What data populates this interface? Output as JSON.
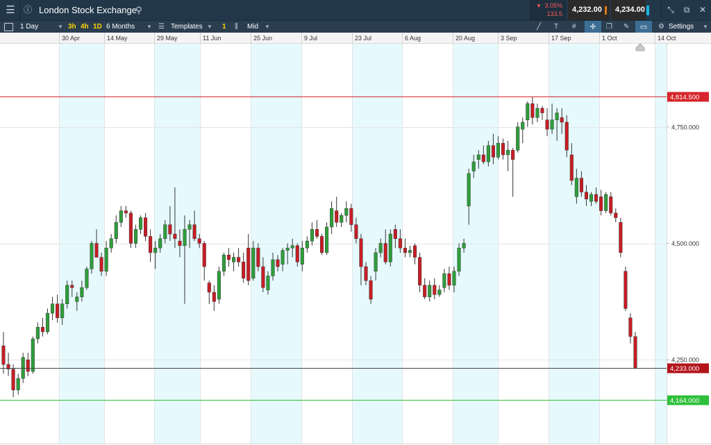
{
  "app": {
    "instrument": "London Stock Exchange",
    "change_pct": "3.05%",
    "change_pts": "133.5",
    "sell_price": "4,232.00",
    "buy_price": "4,234.00"
  },
  "toolbar": {
    "interval": "1 Day",
    "quick_intervals": [
      "3h",
      "4h",
      "1D"
    ],
    "range": "6 Months",
    "templates_label": "Templates",
    "template_count": "1",
    "price_type": "Mid",
    "settings_label": "Settings"
  },
  "colors": {
    "up_candle": "#2e9e3a",
    "down_candle": "#c81d25",
    "high_line": "#d6262b",
    "low_line": "#2fbf3a",
    "current_line": "#444444",
    "highlight_band": "#e6fafd",
    "titlebar": "#22384a",
    "toolbar": "#2a3e50"
  },
  "icons": [
    "menu-icon",
    "info-icon",
    "search-icon",
    "down-arrow-icon",
    "chart-type-icon",
    "candles-icon",
    "draw-line-icon",
    "text-tool-icon",
    "grid-icon",
    "crosshair-icon",
    "layers-icon",
    "drawing-tool-icon",
    "shape-icon",
    "gear-icon",
    "shrink-icon",
    "popout-icon",
    "close-icon"
  ],
  "chart_data": {
    "type": "candlestick",
    "x_tick_labels": [
      "30 Apr",
      "14 May",
      "29 May",
      "11 Jun",
      "25 Jun",
      "9 Jul",
      "23 Jul",
      "6 Aug",
      "20 Aug",
      "3 Sep",
      "17 Sep",
      "1 Oct",
      "14 Oct"
    ],
    "y_ticks": [
      4250,
      4500,
      4750
    ],
    "y_tick_labels": [
      "4,250.000",
      "4,500.000",
      "4,750.000"
    ],
    "ylim": [
      4070,
      4930
    ],
    "grid": true,
    "high_marker": {
      "value": 4814.5,
      "label": "4,814.500"
    },
    "low_marker": {
      "value": 4164.0,
      "label": "4,164.000"
    },
    "current_marker": {
      "value": 4233.0,
      "label": "4,233.000"
    },
    "candles": [
      [
        4280,
        4310,
        4220,
        4240
      ],
      [
        4240,
        4265,
        4215,
        4230
      ],
      [
        4230,
        4240,
        4170,
        4185
      ],
      [
        4185,
        4220,
        4175,
        4210
      ],
      [
        4210,
        4265,
        4200,
        4255
      ],
      [
        4250,
        4265,
        4215,
        4225
      ],
      [
        4225,
        4300,
        4220,
        4295
      ],
      [
        4295,
        4330,
        4285,
        4320
      ],
      [
        4320,
        4340,
        4300,
        4310
      ],
      [
        4310,
        4360,
        4305,
        4350
      ],
      [
        4350,
        4385,
        4335,
        4370
      ],
      [
        4370,
        4390,
        4330,
        4340
      ],
      [
        4340,
        4380,
        4325,
        4370
      ],
      [
        4370,
        4420,
        4360,
        4410
      ],
      [
        4410,
        4420,
        4385,
        4405
      ],
      [
        4375,
        4395,
        4355,
        4385
      ],
      [
        4385,
        4420,
        4375,
        4405
      ],
      [
        4405,
        4450,
        4400,
        4445
      ],
      [
        4445,
        4505,
        4435,
        4500
      ],
      [
        4500,
        4530,
        4470,
        4470
      ],
      [
        4470,
        4480,
        4430,
        4440
      ],
      [
        4440,
        4505,
        4430,
        4490
      ],
      [
        4490,
        4520,
        4480,
        4510
      ],
      [
        4510,
        4560,
        4500,
        4545
      ],
      [
        4545,
        4580,
        4535,
        4570
      ],
      [
        4570,
        4580,
        4555,
        4565
      ],
      [
        4565,
        4570,
        4490,
        4500
      ],
      [
        4500,
        4540,
        4490,
        4530
      ],
      [
        4530,
        4560,
        4520,
        4555
      ],
      [
        4555,
        4565,
        4505,
        4515
      ],
      [
        4515,
        4530,
        4460,
        4480
      ],
      [
        4480,
        4505,
        4445,
        4490
      ],
      [
        4490,
        4520,
        4480,
        4510
      ],
      [
        4510,
        4550,
        4500,
        4540
      ],
      [
        4540,
        4580,
        4505,
        4520
      ],
      [
        4520,
        4620,
        4490,
        4510
      ],
      [
        4505,
        4530,
        4470,
        4495
      ],
      [
        4495,
        4560,
        4370,
        4530
      ],
      [
        4530,
        4550,
        4490,
        4540
      ],
      [
        4540,
        4570,
        4505,
        4510
      ],
      [
        4510,
        4520,
        4490,
        4500
      ],
      [
        4500,
        4505,
        4420,
        4450
      ],
      [
        4415,
        4420,
        4370,
        4395
      ],
      [
        4395,
        4410,
        4355,
        4375
      ],
      [
        4380,
        4450,
        4370,
        4440
      ],
      [
        4440,
        4480,
        4430,
        4475
      ],
      [
        4475,
        4490,
        4450,
        4465
      ],
      [
        4460,
        4480,
        4440,
        4470
      ],
      [
        4470,
        4490,
        4450,
        4460
      ],
      [
        4460,
        4480,
        4415,
        4425
      ],
      [
        4490,
        4520,
        4410,
        4420
      ],
      [
        4425,
        4505,
        4420,
        4490
      ],
      [
        4490,
        4500,
        4440,
        4450
      ],
      [
        4450,
        4470,
        4395,
        4405
      ],
      [
        4400,
        4440,
        4390,
        4430
      ],
      [
        4430,
        4480,
        4420,
        4465
      ],
      [
        4465,
        4475,
        4440,
        4450
      ],
      [
        4455,
        4490,
        4440,
        4485
      ],
      [
        4485,
        4500,
        4455,
        4490
      ],
      [
        4490,
        4510,
        4470,
        4495
      ],
      [
        4495,
        4500,
        4450,
        4460
      ],
      [
        4455,
        4505,
        4440,
        4490
      ],
      [
        4490,
        4515,
        4480,
        4505
      ],
      [
        4505,
        4545,
        4495,
        4530
      ],
      [
        4530,
        4550,
        4510,
        4515
      ],
      [
        4515,
        4520,
        4475,
        4480
      ],
      [
        4480,
        4545,
        4475,
        4535
      ],
      [
        4535,
        4590,
        4520,
        4575
      ],
      [
        4570,
        4600,
        4535,
        4545
      ],
      [
        4545,
        4565,
        4535,
        4560
      ],
      [
        4560,
        4590,
        4545,
        4575
      ],
      [
        4575,
        4585,
        4525,
        4540
      ],
      [
        4540,
        4555,
        4500,
        4510
      ],
      [
        4510,
        4520,
        4410,
        4450
      ],
      [
        4450,
        4460,
        4410,
        4420
      ],
      [
        4420,
        4430,
        4370,
        4380
      ],
      [
        4440,
        4490,
        4420,
        4480
      ],
      [
        4480,
        4510,
        4470,
        4500
      ],
      [
        4500,
        4530,
        4455,
        4460
      ],
      [
        4460,
        4530,
        4450,
        4520
      ],
      [
        4530,
        4540,
        4490,
        4510
      ],
      [
        4510,
        4530,
        4480,
        4490
      ],
      [
        4490,
        4510,
        4470,
        4480
      ],
      [
        4480,
        4495,
        4470,
        4485
      ],
      [
        4495,
        4500,
        4455,
        4470
      ],
      [
        4470,
        4480,
        4395,
        4410
      ],
      [
        4410,
        4425,
        4380,
        4385
      ],
      [
        4385,
        4420,
        4375,
        4410
      ],
      [
        4410,
        4425,
        4380,
        4390
      ],
      [
        4390,
        4410,
        4385,
        4400
      ],
      [
        4405,
        4445,
        4395,
        4435
      ],
      [
        4435,
        4450,
        4400,
        4410
      ],
      [
        4410,
        4450,
        4395,
        4440
      ],
      [
        4440,
        4500,
        4430,
        4490
      ],
      [
        4490,
        4510,
        4480,
        4500
      ],
      [
        4580,
        4660,
        4540,
        4650
      ],
      [
        4655,
        4690,
        4640,
        4675
      ],
      [
        4680,
        4700,
        4660,
        4690
      ],
      [
        4690,
        4710,
        4670,
        4675
      ],
      [
        4675,
        4720,
        4665,
        4710
      ],
      [
        4710,
        4735,
        4670,
        4685
      ],
      [
        4685,
        4730,
        4680,
        4715
      ],
      [
        4715,
        4725,
        4680,
        4690
      ],
      [
        4690,
        4720,
        4655,
        4700
      ],
      [
        4700,
        4705,
        4600,
        4680
      ],
      [
        4700,
        4760,
        4695,
        4750
      ],
      [
        4745,
        4770,
        4715,
        4760
      ],
      [
        4765,
        4805,
        4750,
        4800
      ],
      [
        4800,
        4815,
        4755,
        4770
      ],
      [
        4770,
        4800,
        4760,
        4790
      ],
      [
        4790,
        4795,
        4765,
        4780
      ],
      [
        4765,
        4790,
        4730,
        4745
      ],
      [
        4745,
        4800,
        4735,
        4765
      ],
      [
        4765,
        4790,
        4720,
        4780
      ],
      [
        4770,
        4790,
        4735,
        4760
      ],
      [
        4760,
        4775,
        4685,
        4700
      ],
      [
        4690,
        4715,
        4625,
        4635
      ],
      [
        4600,
        4660,
        4585,
        4640
      ],
      [
        4640,
        4655,
        4600,
        4610
      ],
      [
        4610,
        4625,
        4580,
        4595
      ],
      [
        4590,
        4610,
        4580,
        4605
      ],
      [
        4605,
        4620,
        4585,
        4590
      ],
      [
        4600,
        4615,
        4560,
        4570
      ],
      [
        4570,
        4610,
        4565,
        4605
      ],
      [
        4600,
        4610,
        4560,
        4565
      ],
      [
        4565,
        4575,
        4545,
        4555
      ],
      [
        4545,
        4555,
        4470,
        4480
      ],
      [
        4440,
        4450,
        4355,
        4360
      ],
      [
        4340,
        4350,
        4285,
        4300
      ],
      [
        4300,
        4310,
        4230,
        4233
      ]
    ]
  }
}
